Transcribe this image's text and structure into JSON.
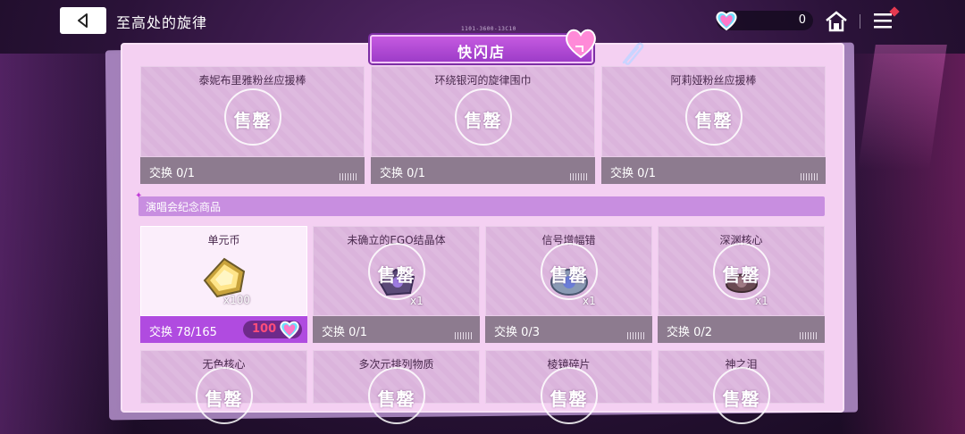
{
  "header": {
    "title": "至高处的旋律",
    "serial": "1101-3600-13C10",
    "currency_value": "0"
  },
  "shop": {
    "tab_label": "快闪店",
    "sold_out_label": "售罄",
    "section_label": "演唱会纪念商品"
  },
  "top_items": [
    {
      "name": "泰妮布里雅粉丝应援棒",
      "exchange": "交换 0/1"
    },
    {
      "name": "环绕银河的旋律围巾",
      "exchange": "交换 0/1"
    },
    {
      "name": "阿莉娅粉丝应援棒",
      "exchange": "交换 0/1"
    }
  ],
  "souvenirs": [
    {
      "name": "单元币",
      "qty": "x100",
      "exchange": "交换 78/165",
      "price": "100",
      "sold_out": false
    },
    {
      "name": "未确立的EGO结晶体",
      "qty": "x1",
      "exchange": "交换 0/1",
      "sold_out": true
    },
    {
      "name": "信号增幅错",
      "qty": "x1",
      "exchange": "交换 0/3",
      "sold_out": true
    },
    {
      "name": "深渊核心",
      "qty": "x1",
      "exchange": "交换 0/2",
      "sold_out": true
    }
  ],
  "bottom_items": [
    {
      "name": "无色核心"
    },
    {
      "name": "多次元排列物质"
    },
    {
      "name": "棱镜碎片"
    },
    {
      "name": "神之泪"
    }
  ],
  "icons": {
    "back": "back-arrow-icon",
    "home": "home-icon",
    "menu": "menu-icon",
    "currency": "heart-crystal-icon"
  },
  "colors": {
    "accent": "#b04be0",
    "price": "#ff4d7a",
    "panel": "#f4d0f2"
  }
}
